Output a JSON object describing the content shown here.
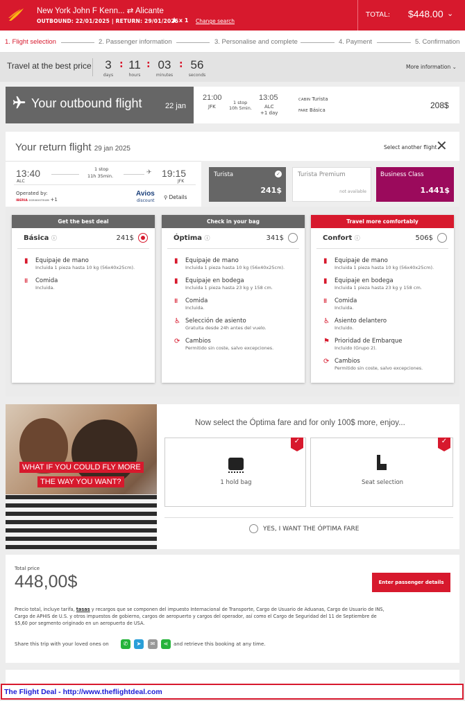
{
  "header": {
    "route_from": "New York John F Kenn...",
    "route_swap_glyph": "⇄",
    "route_to": "Alicante",
    "dates": "OUTBOUND: 22/01/2025 | RETURN: 29/01/2025",
    "pax_count": "x 1",
    "change_search": "Change search",
    "total_label": "TOTAL:",
    "total_value": "$448.00"
  },
  "steps": [
    "1. Flight selection",
    "2. Passenger information",
    "3. Personalise and complete",
    "4. Payment",
    "5. Confirmation"
  ],
  "timer": {
    "label": "Travel at the best price",
    "days": "3",
    "days_label": "days",
    "hours": "11",
    "hours_label": "hours",
    "minutes": "03",
    "minutes_label": "minutes",
    "seconds": "56",
    "seconds_label": "seconds",
    "more": "More information"
  },
  "outbound": {
    "title": "Your outbound flight",
    "date": "22 jan",
    "dep_time": "21:00",
    "dep_code": "JFK",
    "stops": "1 stop",
    "duration": "10h 5min.",
    "arr_time": "13:05",
    "arr_code": "ALC",
    "arr_day": "+1 day",
    "cabin_label": "CABIN",
    "cabin_value": "Turista",
    "fare_label": "FARE",
    "fare_value": "Básica",
    "price": "208$"
  },
  "return": {
    "title": "Your return flight",
    "date": "29 jan 2025",
    "select_another": "Select another flight",
    "dep_time": "13:40",
    "dep_code": "ALC",
    "stops": "1 stop",
    "duration": "11h 35min.",
    "arr_time": "19:15",
    "arr_code": "JFK",
    "operated_by": "Operated by:",
    "operators_more": "+1",
    "avios_main": "Avios",
    "avios_sub": "discount",
    "details": "Details",
    "cabins": [
      {
        "name": "Turista",
        "price": "241$"
      },
      {
        "name": "Turista Premium",
        "price": "not available"
      },
      {
        "name": "Business Class",
        "price": "1.441$"
      }
    ]
  },
  "fares": [
    {
      "banner": "Get the best deal",
      "name": "Básica",
      "price": "241$",
      "features": [
        {
          "icon": "hand-luggage-icon",
          "title": "Equipaje de mano",
          "sub": "Incluida 1 pieza hasta 10 kg (56x40x25cm)."
        },
        {
          "icon": "meal-icon",
          "title": "Comida",
          "sub": "Incluida."
        }
      ]
    },
    {
      "banner": "Check in your bag",
      "name": "Óptima",
      "price": "341$",
      "features": [
        {
          "icon": "hand-luggage-icon",
          "title": "Equipaje de mano",
          "sub": "Incluida 1 pieza hasta 10 kg (56x40x25cm)."
        },
        {
          "icon": "checked-bag-icon",
          "title": "Equipaje en bodega",
          "sub": "Incluida 1 pieza hasta 23 kg y 158 cm."
        },
        {
          "icon": "meal-icon",
          "title": "Comida",
          "sub": "Incluida."
        },
        {
          "icon": "seat-icon",
          "title": "Selección de asiento",
          "sub": "Gratuita desde 24h antes del vuelo."
        },
        {
          "icon": "change-icon",
          "title": "Cambios",
          "sub": "Permitido sin coste, salvo excepciones."
        }
      ]
    },
    {
      "banner": "Travel more comfortably",
      "name": "Confort",
      "price": "506$",
      "features": [
        {
          "icon": "hand-luggage-icon",
          "title": "Equipaje de mano",
          "sub": "Incluida 1 pieza hasta 10 kg (56x40x25cm)."
        },
        {
          "icon": "checked-bag-icon",
          "title": "Equipaje en bodega",
          "sub": "Incluida 1 pieza hasta 23 kg y 158 cm."
        },
        {
          "icon": "meal-icon",
          "title": "Comida",
          "sub": "Incluida."
        },
        {
          "icon": "seat-icon",
          "title": "Asiento delantero",
          "sub": "Incluido."
        },
        {
          "icon": "priority-icon",
          "title": "Prioridad de Embarque",
          "sub": "Incluido (Grupo 2)."
        },
        {
          "icon": "change-icon",
          "title": "Cambios",
          "sub": "Permitido sin coste, salvo excepciones."
        }
      ]
    }
  ],
  "promo": {
    "line1": "WHAT IF YOU COULD FLY MORE",
    "line2": "THE WAY YOU WANT?",
    "heading": "Now select the Óptima fare and for only 100$ more, enjoy...",
    "tile1": "1 hold bag",
    "tile2": "Seat selection",
    "opt_in": "YES, I WANT THE ÓPTIMA FARE"
  },
  "total": {
    "label": "Total price",
    "value": "448,00$",
    "cta": "Enter passenger details",
    "disclaimer_pre": "Precio total, incluye tarifa,",
    "disclaimer_link": "tasas",
    "disclaimer_l1": "y recargos que se componen del impuesto Internacional de Transporte, Cargo de Usuario de Aduanas, Cargo de Usuario de INS,",
    "disclaimer_l2": "Cargo de APHIS de U.S. y otros impuestos de gobierno, cargos de aeropuerto y cargos del operador, así como el Cargo de Seguridad del 11 de Septiembre de",
    "disclaimer_l3": "$5,60 por segmento originado en un aeropuerto de USA.",
    "share_pre": "Share this trip with your loved ones on",
    "share_post": "and retrieve this booking at any time."
  },
  "footer": "The Flight Deal - http://www.theflightdeal.com",
  "colors": {
    "brand_red": "#d7192d",
    "business": "#9b0a5c",
    "dark_panel": "#666666"
  }
}
